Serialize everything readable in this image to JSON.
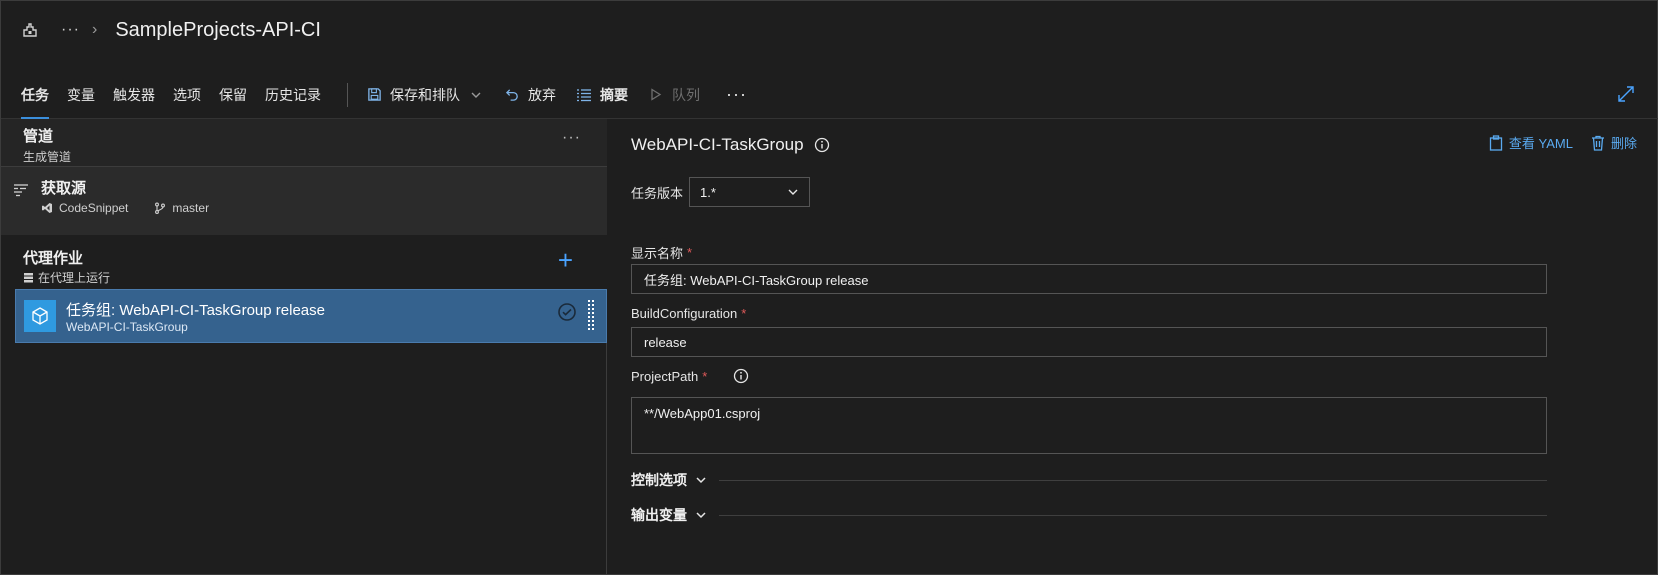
{
  "header": {
    "title": "SampleProjects-API-CI",
    "more": "···",
    "breadcrumb_chevron": "›",
    "pipeline_icon": "pipeline-icon"
  },
  "toolbar": {
    "tabs": [
      {
        "label": "任务",
        "active": true
      },
      {
        "label": "变量"
      },
      {
        "label": "触发器"
      },
      {
        "label": "选项"
      },
      {
        "label": "保留"
      },
      {
        "label": "历史记录"
      }
    ],
    "save_queue": "保存和排队",
    "discard": "放弃",
    "summary": "摘要",
    "queue": "队列",
    "more": "···"
  },
  "left": {
    "pipeline": {
      "title": "管道",
      "subtitle": "生成管道",
      "more": "···"
    },
    "source": {
      "title": "获取源",
      "repo": "CodeSnippet",
      "branch": "master"
    },
    "agent_job": {
      "title": "代理作业",
      "subtitle": "在代理上运行",
      "add": "+"
    },
    "task": {
      "title": "任务组: WebAPI-CI-TaskGroup release",
      "subtitle": "WebAPI-CI-TaskGroup"
    }
  },
  "right": {
    "title": "WebAPI-CI-TaskGroup",
    "view_yaml": "查看 YAML",
    "delete": "删除",
    "task_version_label": "任务版本",
    "task_version_value": "1.*",
    "display_name_label": "显示名称",
    "display_name_value": "任务组: WebAPI-CI-TaskGroup release",
    "build_config_label": "BuildConfiguration",
    "build_config_value": "release",
    "project_path_label": "ProjectPath",
    "project_path_value": "**/WebApp01.csproj",
    "required_mark": "*",
    "control_options": "控制选项",
    "output_variables": "输出变量"
  },
  "colors": {
    "accent": "#3b8fdc",
    "link": "#5aaaf0",
    "selected_row": "#35628e",
    "required": "#e05a5a"
  }
}
